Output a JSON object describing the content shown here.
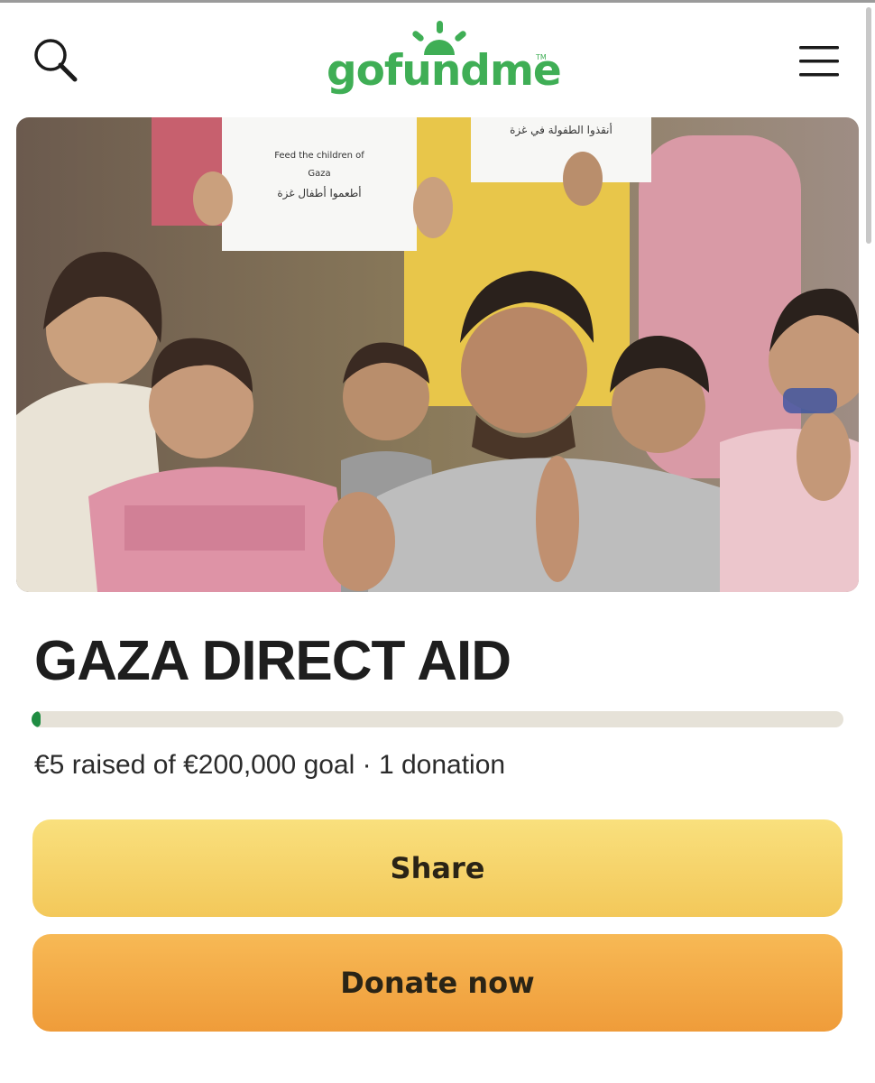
{
  "header": {
    "logo_text": "gofundme",
    "logo_tm": "TM",
    "search_icon": "search-icon",
    "menu_icon": "hamburger-menu-icon"
  },
  "hero": {
    "sign_left_line1": "Feed the children of",
    "sign_left_line2": "Gaza",
    "sign_left_line3": "أطعموا أطفال غزة",
    "sign_right_line1": "أنقذوا الطفولة في غزة"
  },
  "campaign": {
    "title": "GAZA DIRECT AID",
    "progress_fraction": 2.5e-05,
    "stats": "€5 raised of €200,000 goal · 1 donation"
  },
  "actions": {
    "share_label": "Share",
    "donate_label": "Donate now"
  },
  "colors": {
    "brand_green": "#3fae55",
    "progress_fill": "#1f8c42",
    "share_button": "#f3c85a",
    "donate_button": "#ef9c3a"
  }
}
